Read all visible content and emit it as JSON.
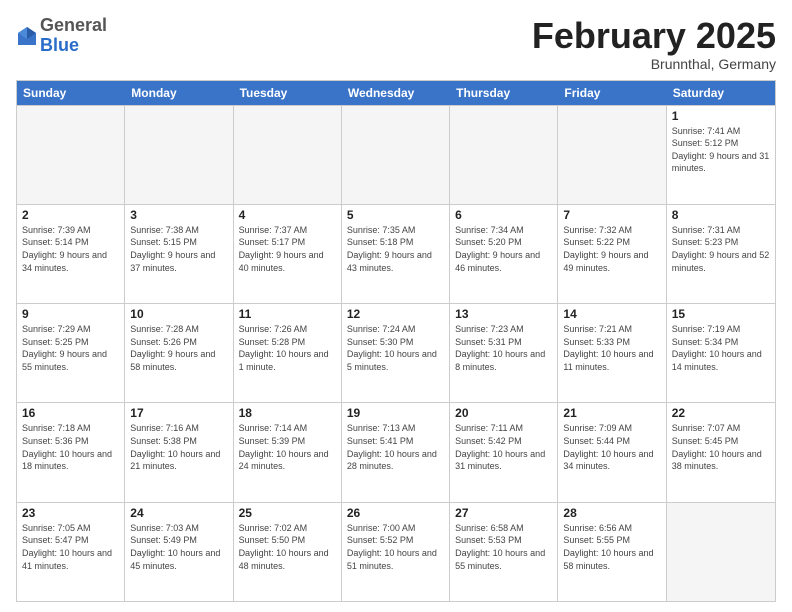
{
  "header": {
    "logo_general": "General",
    "logo_blue": "Blue",
    "title": "February 2025",
    "subtitle": "Brunnthal, Germany"
  },
  "days_of_week": [
    "Sunday",
    "Monday",
    "Tuesday",
    "Wednesday",
    "Thursday",
    "Friday",
    "Saturday"
  ],
  "weeks": [
    [
      {
        "day": "",
        "empty": true
      },
      {
        "day": "",
        "empty": true
      },
      {
        "day": "",
        "empty": true
      },
      {
        "day": "",
        "empty": true
      },
      {
        "day": "",
        "empty": true
      },
      {
        "day": "",
        "empty": true
      },
      {
        "day": "1",
        "info": "Sunrise: 7:41 AM\nSunset: 5:12 PM\nDaylight: 9 hours and 31 minutes."
      }
    ],
    [
      {
        "day": "2",
        "info": "Sunrise: 7:39 AM\nSunset: 5:14 PM\nDaylight: 9 hours and 34 minutes."
      },
      {
        "day": "3",
        "info": "Sunrise: 7:38 AM\nSunset: 5:15 PM\nDaylight: 9 hours and 37 minutes."
      },
      {
        "day": "4",
        "info": "Sunrise: 7:37 AM\nSunset: 5:17 PM\nDaylight: 9 hours and 40 minutes."
      },
      {
        "day": "5",
        "info": "Sunrise: 7:35 AM\nSunset: 5:18 PM\nDaylight: 9 hours and 43 minutes."
      },
      {
        "day": "6",
        "info": "Sunrise: 7:34 AM\nSunset: 5:20 PM\nDaylight: 9 hours and 46 minutes."
      },
      {
        "day": "7",
        "info": "Sunrise: 7:32 AM\nSunset: 5:22 PM\nDaylight: 9 hours and 49 minutes."
      },
      {
        "day": "8",
        "info": "Sunrise: 7:31 AM\nSunset: 5:23 PM\nDaylight: 9 hours and 52 minutes."
      }
    ],
    [
      {
        "day": "9",
        "info": "Sunrise: 7:29 AM\nSunset: 5:25 PM\nDaylight: 9 hours and 55 minutes."
      },
      {
        "day": "10",
        "info": "Sunrise: 7:28 AM\nSunset: 5:26 PM\nDaylight: 9 hours and 58 minutes."
      },
      {
        "day": "11",
        "info": "Sunrise: 7:26 AM\nSunset: 5:28 PM\nDaylight: 10 hours and 1 minute."
      },
      {
        "day": "12",
        "info": "Sunrise: 7:24 AM\nSunset: 5:30 PM\nDaylight: 10 hours and 5 minutes."
      },
      {
        "day": "13",
        "info": "Sunrise: 7:23 AM\nSunset: 5:31 PM\nDaylight: 10 hours and 8 minutes."
      },
      {
        "day": "14",
        "info": "Sunrise: 7:21 AM\nSunset: 5:33 PM\nDaylight: 10 hours and 11 minutes."
      },
      {
        "day": "15",
        "info": "Sunrise: 7:19 AM\nSunset: 5:34 PM\nDaylight: 10 hours and 14 minutes."
      }
    ],
    [
      {
        "day": "16",
        "info": "Sunrise: 7:18 AM\nSunset: 5:36 PM\nDaylight: 10 hours and 18 minutes."
      },
      {
        "day": "17",
        "info": "Sunrise: 7:16 AM\nSunset: 5:38 PM\nDaylight: 10 hours and 21 minutes."
      },
      {
        "day": "18",
        "info": "Sunrise: 7:14 AM\nSunset: 5:39 PM\nDaylight: 10 hours and 24 minutes."
      },
      {
        "day": "19",
        "info": "Sunrise: 7:13 AM\nSunset: 5:41 PM\nDaylight: 10 hours and 28 minutes."
      },
      {
        "day": "20",
        "info": "Sunrise: 7:11 AM\nSunset: 5:42 PM\nDaylight: 10 hours and 31 minutes."
      },
      {
        "day": "21",
        "info": "Sunrise: 7:09 AM\nSunset: 5:44 PM\nDaylight: 10 hours and 34 minutes."
      },
      {
        "day": "22",
        "info": "Sunrise: 7:07 AM\nSunset: 5:45 PM\nDaylight: 10 hours and 38 minutes."
      }
    ],
    [
      {
        "day": "23",
        "info": "Sunrise: 7:05 AM\nSunset: 5:47 PM\nDaylight: 10 hours and 41 minutes."
      },
      {
        "day": "24",
        "info": "Sunrise: 7:03 AM\nSunset: 5:49 PM\nDaylight: 10 hours and 45 minutes."
      },
      {
        "day": "25",
        "info": "Sunrise: 7:02 AM\nSunset: 5:50 PM\nDaylight: 10 hours and 48 minutes."
      },
      {
        "day": "26",
        "info": "Sunrise: 7:00 AM\nSunset: 5:52 PM\nDaylight: 10 hours and 51 minutes."
      },
      {
        "day": "27",
        "info": "Sunrise: 6:58 AM\nSunset: 5:53 PM\nDaylight: 10 hours and 55 minutes."
      },
      {
        "day": "28",
        "info": "Sunrise: 6:56 AM\nSunset: 5:55 PM\nDaylight: 10 hours and 58 minutes."
      },
      {
        "day": "",
        "empty": true
      }
    ]
  ]
}
